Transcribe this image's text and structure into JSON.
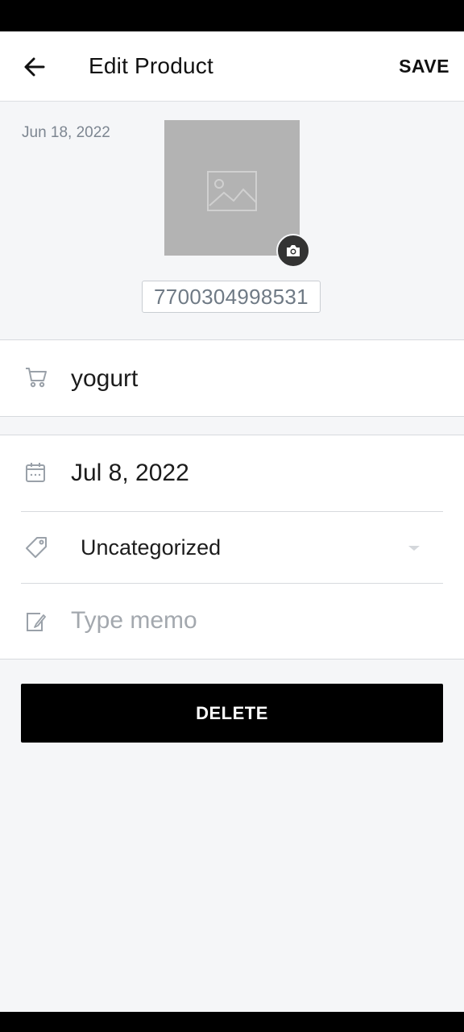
{
  "appbar": {
    "title": "Edit Product",
    "save_label": "SAVE"
  },
  "header": {
    "created_date": "Jun 18, 2022",
    "barcode": "7700304998531"
  },
  "product": {
    "name": "yogurt"
  },
  "details": {
    "expiry_date": "Jul 8, 2022",
    "category": "Uncategorized",
    "memo_placeholder": "Type memo"
  },
  "actions": {
    "delete_label": "DELETE"
  },
  "colors": {
    "accent": "#000000",
    "background": "#f5f6f8",
    "muted_text": "#7d8691"
  },
  "icons": [
    "back-arrow-icon",
    "image-placeholder-icon",
    "camera-icon",
    "cart-icon",
    "calendar-icon",
    "tag-icon",
    "chevron-down-icon",
    "memo-edit-icon"
  ]
}
